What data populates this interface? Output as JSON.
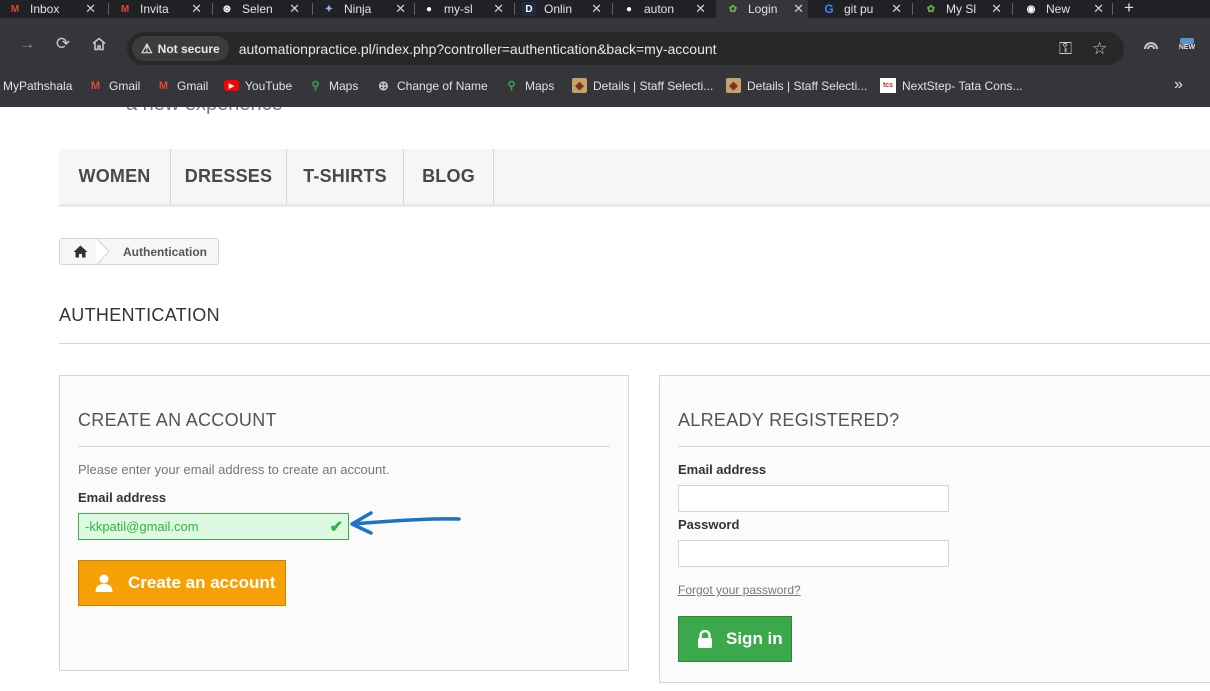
{
  "browser": {
    "tabs": [
      {
        "label": "Inbox",
        "icon": "gmail-icon",
        "color": "#ea4335",
        "glyph": "M"
      },
      {
        "label": "Invita",
        "icon": "gmail-icon",
        "color": "#ea4335",
        "glyph": "M"
      },
      {
        "label": "Selen",
        "icon": "chatgpt-icon",
        "color": "#ffffff",
        "glyph": "⊛"
      },
      {
        "label": "Ninja",
        "icon": "ninja-icon",
        "color": "#8ab4f8",
        "glyph": "✦"
      },
      {
        "label": "my-sl",
        "icon": "github-icon",
        "color": "#ffffff",
        "glyph": "●"
      },
      {
        "label": "Onlin",
        "icon": "d-icon",
        "color": "#1f2a44",
        "glyph": "D"
      },
      {
        "label": "auton",
        "icon": "github-icon",
        "color": "#ffffff",
        "glyph": "●"
      },
      {
        "label": "Login",
        "icon": "shop-icon",
        "color": "#6aa84f",
        "glyph": "✿",
        "active": true
      },
      {
        "label": "git pu",
        "icon": "google-icon",
        "color": "#4285f4",
        "glyph": "G"
      },
      {
        "label": "My Sl",
        "icon": "shop-icon",
        "color": "#6aa84f",
        "glyph": "✿"
      },
      {
        "label": "New",
        "icon": "chrome-icon",
        "color": "#ffffff",
        "glyph": "◉"
      }
    ],
    "new_tab": "+",
    "security_label": "Not secure",
    "url": "automationpractice.pl/index.php?controller=authentication&back=my-account",
    "new_badge": "NEW",
    "bookmarks": [
      {
        "label": "MyPathshala",
        "icon": ""
      },
      {
        "label": "Gmail",
        "icon": "gmail-icon"
      },
      {
        "label": "Gmail",
        "icon": "gmail-icon"
      },
      {
        "label": "YouTube",
        "icon": "youtube-icon"
      },
      {
        "label": "Maps",
        "icon": "maps-icon"
      },
      {
        "label": "Change of Name",
        "icon": "globe-icon"
      },
      {
        "label": "Maps",
        "icon": "maps-icon"
      },
      {
        "label": "Details | Staff Selecti...",
        "icon": "ssc-icon"
      },
      {
        "label": "Details | Staff Selecti...",
        "icon": "ssc-icon"
      },
      {
        "label": "NextStep- Tata Cons...",
        "icon": "tcs-icon"
      }
    ],
    "bookmarks_more": "»"
  },
  "page": {
    "tagline": "a new experience",
    "menu": [
      "WOMEN",
      "DRESSES",
      "T-SHIRTS",
      "BLOG"
    ],
    "breadcrumb": "Authentication",
    "heading": "AUTHENTICATION",
    "create": {
      "title": "CREATE AN ACCOUNT",
      "hint": "Please enter your email address to create an account.",
      "email_label": "Email address",
      "email_value": "-kkpatil@gmail.com",
      "button": "Create an account"
    },
    "login": {
      "title": "ALREADY REGISTERED?",
      "email_label": "Email address",
      "email_value": "",
      "password_label": "Password",
      "password_value": "",
      "forgot": "Forgot your password?",
      "button": "Sign in"
    }
  },
  "colors": {
    "orange": "#f7a006",
    "green": "#3aa84b",
    "valid": "#35b33f",
    "annotation": "#1a73c8"
  }
}
